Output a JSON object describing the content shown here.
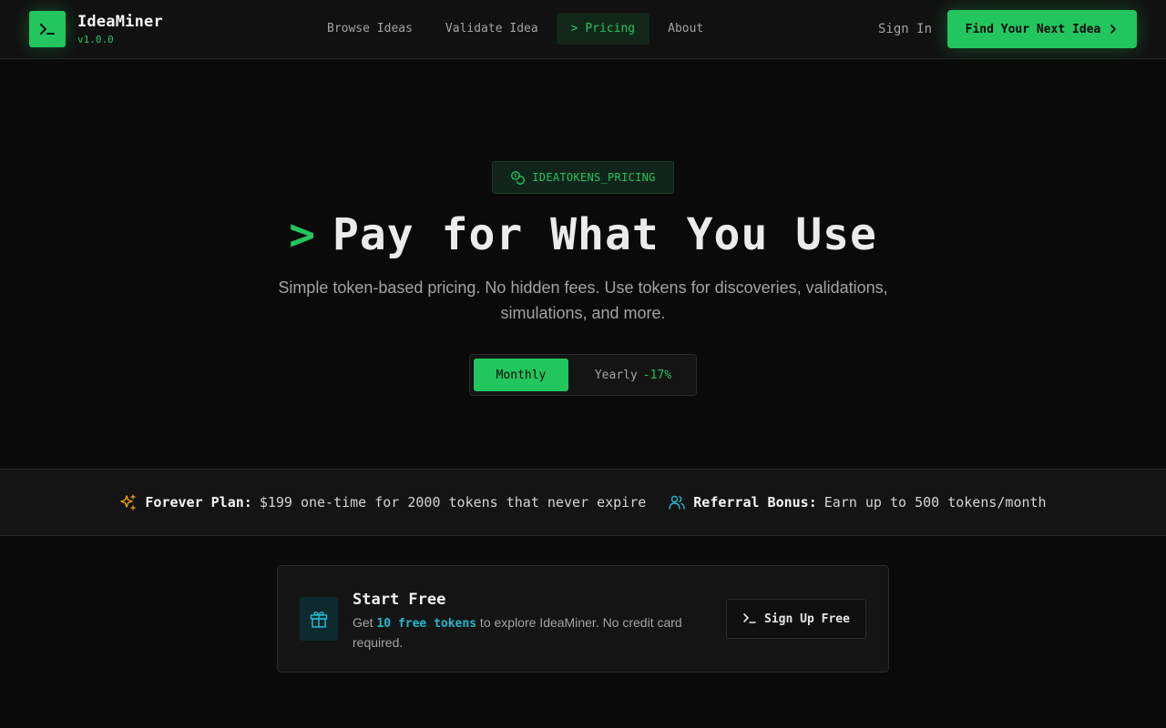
{
  "header": {
    "logo_name": "IdeaMiner",
    "version": "v1.0.0",
    "nav": [
      {
        "label": "Browse Ideas",
        "active": false
      },
      {
        "label": "Validate Idea",
        "active": false
      },
      {
        "label": "> Pricing",
        "active": true
      },
      {
        "label": "About",
        "active": false
      }
    ],
    "sign_in": "Sign In",
    "cta": "Find Your Next Idea"
  },
  "hero": {
    "badge": "IDEATOKENS_PRICING",
    "prompt": ">",
    "title": "Pay for What You Use",
    "subtitle": "Simple token-based pricing. No hidden fees. Use tokens for discoveries, validations, simulations, and more.",
    "toggle": {
      "monthly": "Monthly",
      "yearly": "Yearly",
      "yearly_discount": "-17%",
      "selected": "Monthly"
    }
  },
  "strip": {
    "forever_label": "Forever Plan:",
    "forever_text": "$199 one-time for 2000 tokens that never expire",
    "referral_label": "Referral Bonus:",
    "referral_text": "Earn up to 500 tokens/month"
  },
  "start_free": {
    "title": "Start Free",
    "desc_prefix": "Get ",
    "desc_highlight": "10 free tokens",
    "desc_suffix": " to explore IdeaMiner. No credit card required.",
    "button": "Sign Up Free"
  },
  "colors": {
    "accent": "#22c55e",
    "background": "#0a0a0a",
    "surface": "#141414",
    "highlight_cyan": "#22b8cf",
    "sparkle_orange": "#f59e0b"
  },
  "icons": {
    "logo": "terminal-icon",
    "cta": "chevron-right-icon",
    "badge": "coins-icon",
    "forever": "sparkles-icon",
    "referral": "users-icon",
    "start_free": "gift-icon",
    "signup": "terminal-icon"
  }
}
